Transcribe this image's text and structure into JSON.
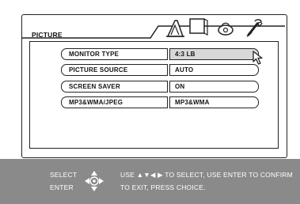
{
  "header": {
    "section_title": "PICTURE",
    "tabs": [
      {
        "name": "picture-tab",
        "icon": "picture-icon"
      },
      {
        "name": "display-tab",
        "icon": "monitor-icon"
      },
      {
        "name": "audio-tab",
        "icon": "speaker-icon"
      },
      {
        "name": "setup-tab",
        "icon": "wrench-icon"
      }
    ]
  },
  "settings": [
    {
      "label": "MONITOR TYPE",
      "value": "4:3 LB",
      "selected": true
    },
    {
      "label": "PICTURE SOURCE",
      "value": "AUTO",
      "selected": false
    },
    {
      "label": "SCREEN SAVER",
      "value": "ON",
      "selected": false
    },
    {
      "label": "MP3&WMA/JPEG",
      "value": "MP3&WMA",
      "selected": false
    }
  ],
  "footer": {
    "select_label": "SELECT",
    "enter_label": "ENTER",
    "instruction_line1": "USE ▲▼◀ ▶ TO SELECT, USE ENTER TO CONFIRM",
    "instruction_line2": "TO EXIT, PRESS CHOICE."
  },
  "colors": {
    "footer_bg": "#8a8a8a",
    "selected_value_bg": "#d8d8d8",
    "outline": "#222222"
  }
}
